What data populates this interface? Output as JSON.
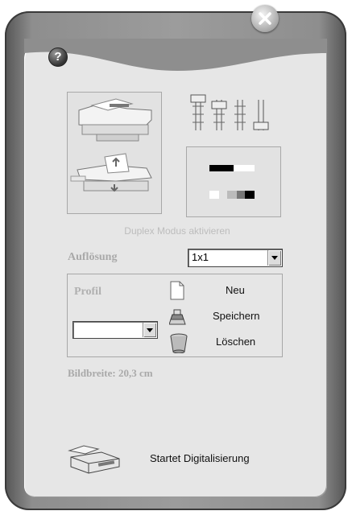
{
  "window": {
    "help_label": "?",
    "close_label": "×"
  },
  "scan": {
    "duplex_label": "Duplex Modus aktivieren"
  },
  "resolution": {
    "label": "Auflösung",
    "value": "1x1"
  },
  "profile": {
    "label": "Profil",
    "selected": "",
    "new_label": "Neu",
    "save_label": "Speichern",
    "delete_label": "Löschen"
  },
  "image_width": {
    "label": "Bildbreite: 20,3 cm"
  },
  "start": {
    "label": "Startet Digitalisierung"
  }
}
